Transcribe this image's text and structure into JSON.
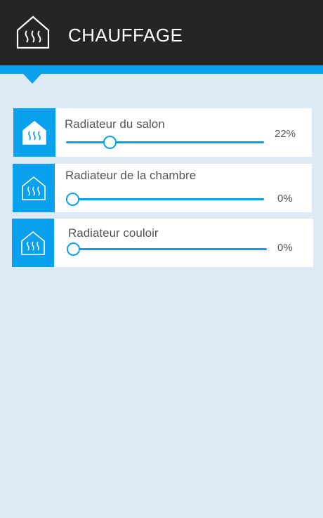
{
  "header": {
    "title": "CHAUFFAGE",
    "icon": "heating-house-icon"
  },
  "colors": {
    "header_bg": "#252525",
    "accent": "#0aa0f0",
    "page_bg": "#dde9f5",
    "card_bg": "#ffffff",
    "text": "#555555"
  },
  "radiators": [
    {
      "label": "Radiateur du salon",
      "value_label": "22%",
      "level": 22,
      "icon": "heating-house-filled-icon"
    },
    {
      "label": "Radiateur de la chambre",
      "value_label": "0%",
      "level": 0,
      "icon": "heating-house-outline-icon"
    },
    {
      "label": "Radiateur couloir",
      "value_label": "0%",
      "level": 0,
      "icon": "heating-house-outline-icon"
    }
  ]
}
